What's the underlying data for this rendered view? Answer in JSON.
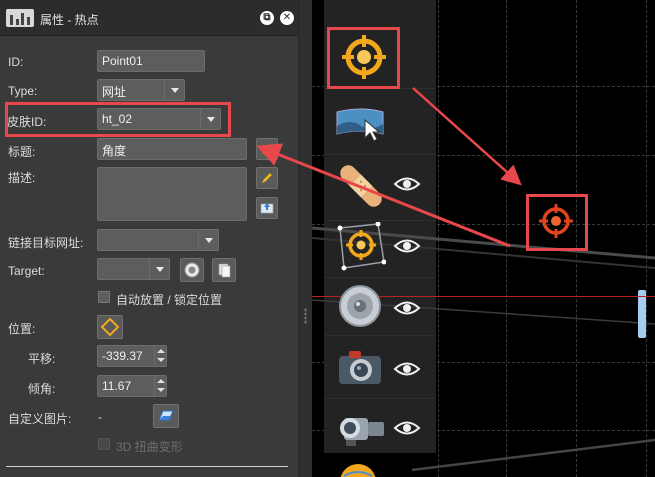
{
  "window": {
    "title": "属性 - 热点",
    "app_icon": "panel-icon",
    "restore_icon": "restore-icon",
    "close_icon": "close-icon"
  },
  "form": {
    "id_label": "ID:",
    "id_value": "Point01",
    "type_label": "Type:",
    "type_value": "网址",
    "skin_label": "皮肤ID:",
    "skin_value": "ht_02",
    "title_label": "标题:",
    "title_value": "角度",
    "desc_label": "描述:",
    "desc_value": "",
    "link_label": "链接目标网址:",
    "link_value": "",
    "target_label": "Target:",
    "target_value": "",
    "auto_place_label": "自动放置 / 锁定位置",
    "auto_place_checked": false,
    "position_label": "位置:",
    "pan_label": "平移:",
    "pan_value": "-339.37",
    "tilt_label": "倾角:",
    "tilt_value": "11.67",
    "custom_image_label": "自定义图片:",
    "custom_image_value": "-",
    "distort_label": "3D 扭曲变形",
    "distort_checked": false
  },
  "canvas": {
    "palette_icons": [
      "crosshair-hotspot-icon",
      "panorama-pointer-icon",
      "bandage-icon",
      "target-shape-icon",
      "speaker-icon",
      "camera-icon",
      "video-camera-icon",
      "globe-icon"
    ],
    "selected_hotspot": "crosshair-hotspot-icon",
    "highlight_color": "#e8474c",
    "accent_orange": "#f2a81d",
    "hotspot_red": "#e0441c"
  }
}
